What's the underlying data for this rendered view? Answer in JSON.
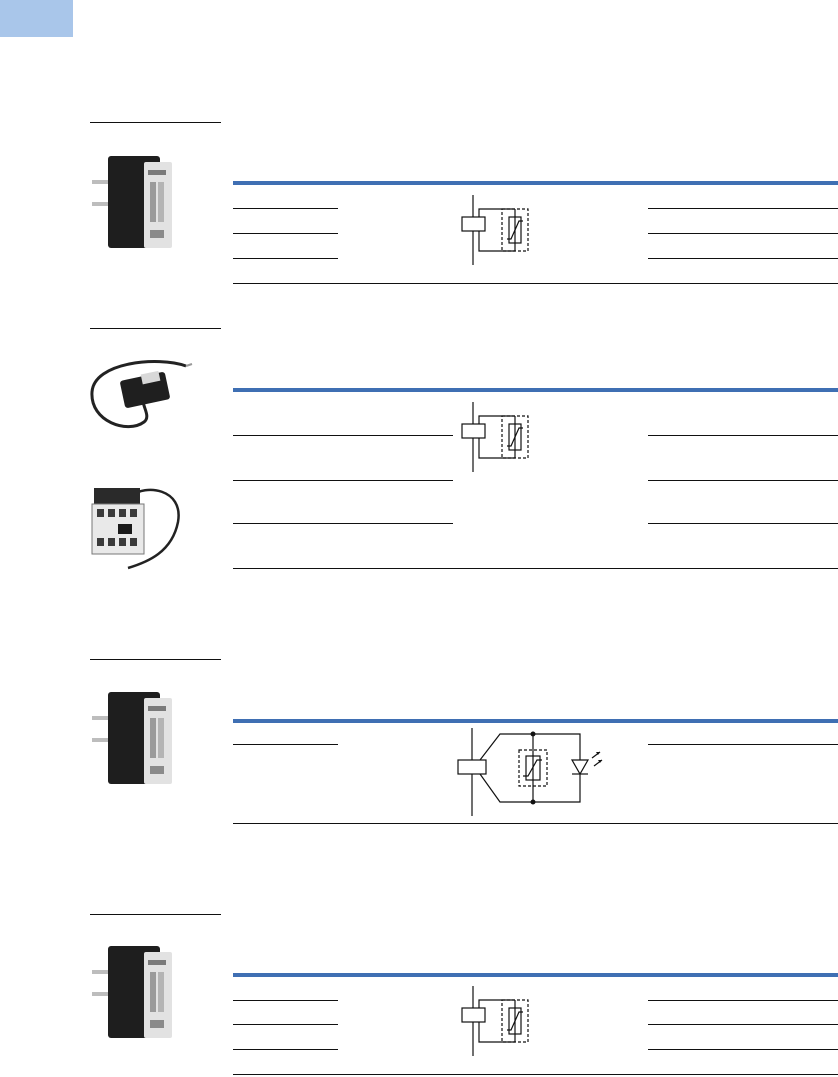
{
  "page": {
    "accent_color": "#a9c6ea",
    "rule_color": "#3f6fb3"
  },
  "sections": [
    {
      "photo_icon": "plug-in-suppressor-module-photo",
      "diagram_icon": "coil-varistor-circuit-icon",
      "text": []
    },
    {
      "photo_icon": "suppressor-module-with-cable-photo",
      "second_photo_icon": "contactor-with-mounted-suppressor-photo",
      "diagram_icon": "coil-varistor-circuit-icon",
      "text": []
    },
    {
      "photo_icon": "plug-in-suppressor-module-photo",
      "diagram_icon": "coil-varistor-led-circuit-icon",
      "text": []
    },
    {
      "photo_icon": "plug-in-suppressor-module-photo",
      "diagram_icon": "coil-varistor-circuit-icon",
      "text": []
    }
  ]
}
